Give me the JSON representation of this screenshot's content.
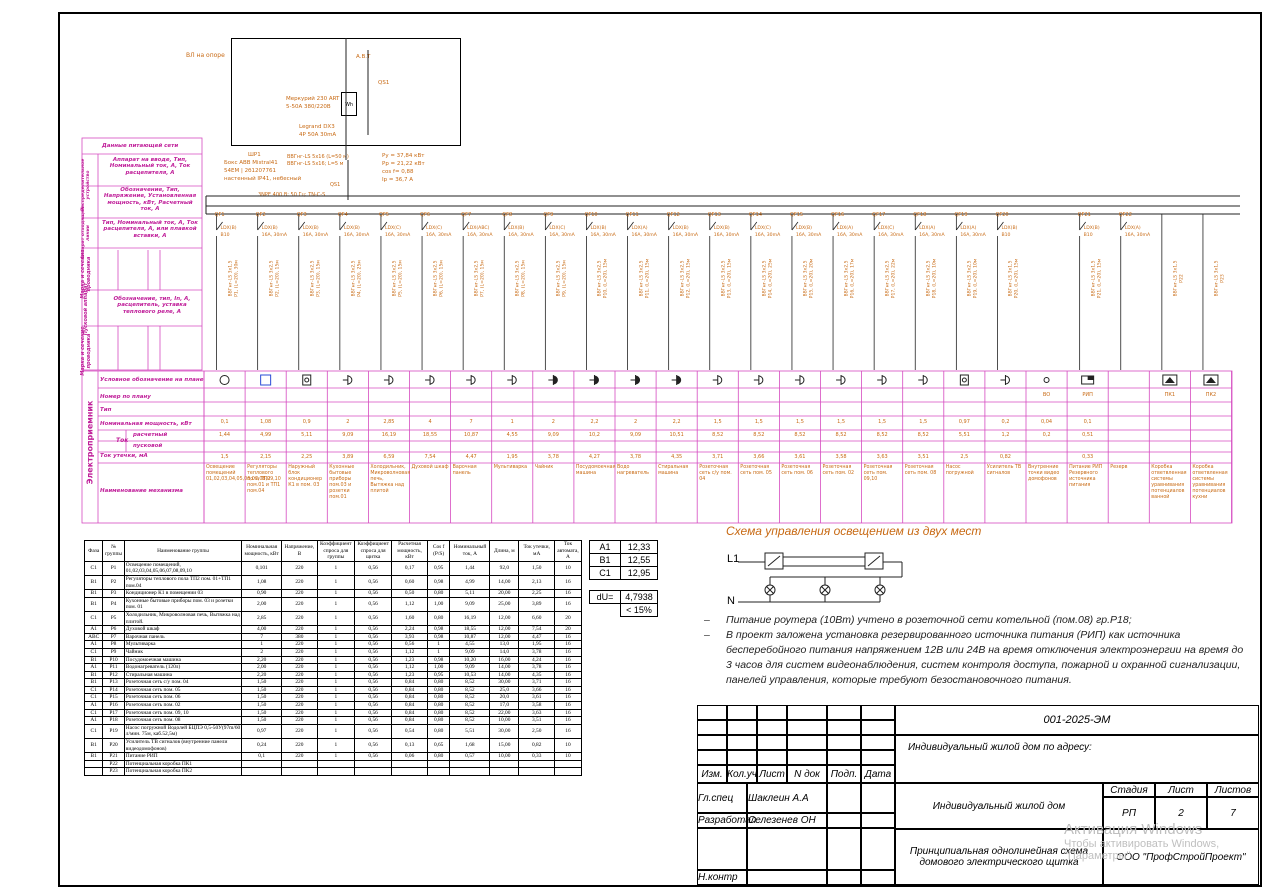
{
  "meter": {
    "pole_label": "ВЛ на опоре",
    "breaker_top": "А.В.Т",
    "qs_label": "QS1",
    "meter_name": "Меркурий 230 ART",
    "meter_spec": "5-50А 380/220В",
    "wh_label": "Wh",
    "legrand": "Legrand DX3",
    "legrand_spec": "4P 50А 30mA",
    "qf_label": "QF1"
  },
  "panel_info": {
    "wp": "ШР1",
    "box": "Бокс ABB Mistral41",
    "box2": "54ЕМ | 2б1207761",
    "box3": "настенный IP41, небесный",
    "cable": "ВВГнг-LS 5х16 (L=50 м)",
    "cable2": "ВВГнг-LS 5х16; L=5 м",
    "pu": "Ру = 37,84 кВт",
    "pr": "Рр = 21,22 кВт",
    "cos": "cos f= 0,88",
    "ir": "Iр = 36,7 А",
    "bus_label": "3NPE 400 В; 50 Гц; TN-C-S",
    "qs2": "QS1"
  },
  "left_labels": {
    "supply": "Данные питающей сети",
    "apparatus": "Аппарат на вводе, Тип, Номинальный ток, А, Ток расцепителя, А",
    "dist": "Распределительное устройство",
    "designation": "Обозначение, Тип, Напряжение, Установленная мощность, кВт, Расчетный ток, А",
    "apparatus2": "Аппарат отходящей линии",
    "type2": "Тип, Номинальный ток, А, Ток расцепителя, А, или плавкой вставки, А",
    "brand": "Марка и сечение проводника",
    "section": "Обозначение, участок сети, длина, м",
    "pipe": "Обозначение трубы",
    "start": "Пусковой аппарат",
    "start_desc": "Обозначение, тип, In, А, расцепитель, уставка теплового реле, А",
    "brand2": "Марка и сечение проводника",
    "receiver": "Электроприемник"
  },
  "receiver_rows": {
    "symbol": "Условное обозначение на плане",
    "plan": "Номер по плану",
    "type": "Тип",
    "power": "Номинальная мощность, кВт",
    "current": "Ток",
    "calc": "расчетный",
    "start": "пусковой",
    "leak": "Ток утечки, мА",
    "name": "Наименование механизма"
  },
  "circuits": [
    {
      "qf": "QF1",
      "ap": "LDX(B)",
      "rat": "B10",
      "cab": "ВВГнг-LS 3х1,5",
      "grp": "Р1, (L=20), 30м",
      "sym": "circle",
      "plan": "",
      "p": "0,1",
      "ic": "1,44",
      "leak": "1,5",
      "name": "Освещение помещений 01,02,03,04,05,06,07,08,09,10"
    },
    {
      "qf": "QF2",
      "ap": "LDX(B)",
      "rat": "16А, 30mA",
      "cab": "ВВГнг-LS 3х2,5",
      "grp": "Р2, (L=20), 15м",
      "sym": "square-blue",
      "plan": "",
      "p": "1,08",
      "ic": "4,99",
      "leak": "2,15",
      "name": "Регуляторы теплового пола ТП2 пом.01 и ТП1 пом.04"
    },
    {
      "qf": "QF3",
      "ap": "LDX(B)",
      "rat": "16А, 30mA",
      "cab": "ВВГнг-LS 3х2,5",
      "grp": "Р3, (L=20), 15м",
      "sym": "square-o",
      "plan": "",
      "p": "0,9",
      "ic": "5,11",
      "leak": "2,25",
      "name": "Наружный блок кондиционер К1 в пом. 03"
    },
    {
      "qf": "QF4",
      "ap": "LDX(B)",
      "rat": "16А, 30mA",
      "cab": "ВВГнг-LS 3х2,5",
      "grp": "Р4, (L=20), 25м",
      "sym": "plug",
      "plan": "",
      "p": "2",
      "ic": "9,09",
      "leak": "3,89",
      "name": "Кухонные бытовые приборы пом.03 и розетки пом.01"
    },
    {
      "qf": "QF5",
      "ap": "LDX(C)",
      "rat": "16А, 30mA",
      "cab": "ВВГнг-LS 3х2,5",
      "grp": "Р5, (L=20), 15м",
      "sym": "plug",
      "plan": "",
      "p": "2,85",
      "ic": "16,19",
      "leak": "6,59",
      "name": "Холодильник, Микроволновая печь, Вытяжка над плитой"
    },
    {
      "qf": "QF6",
      "ap": "LDX(C)",
      "rat": "16А, 30mA",
      "cab": "ВВГнг-LS 3х2,5",
      "grp": "Р6, (L=20), 15м",
      "sym": "plug",
      "plan": "",
      "p": "4",
      "ic": "18,55",
      "leak": "7,54",
      "name": "Духовой шкаф"
    },
    {
      "qf": "QF7",
      "ap": "LDX(ABC)",
      "rat": "16А, 30mA",
      "cab": "ВВГнг-LS 3х2,5",
      "grp": "Р7, (L=20), 15м",
      "sym": "plug",
      "plan": "",
      "p": "7",
      "ic": "10,87",
      "leak": "4,47",
      "name": "Варочная панель"
    },
    {
      "qf": "QF8",
      "ap": "LDX(B)",
      "rat": "16А, 30mA",
      "cab": "ВВГнг-LS 3х2,5",
      "grp": "Р8, (L=20), 15м",
      "sym": "plug",
      "plan": "",
      "p": "1",
      "ic": "4,55",
      "leak": "1,95",
      "name": "Мультиварка"
    },
    {
      "qf": "QF9",
      "ap": "LDX(C)",
      "rat": "16А, 30mA",
      "cab": "ВВГнг-LS 3х2,5",
      "grp": "Р9, (L=20), 15м",
      "sym": "plug-filled",
      "plan": "",
      "p": "2",
      "ic": "9,09",
      "leak": "3,78",
      "name": "Чайник"
    },
    {
      "qf": "QF10",
      "ap": "LDX(B)",
      "rat": "16А, 30mA",
      "cab": "ВВГнг-LS 3х2,5",
      "grp": "Р10, (L=20), 15м",
      "sym": "plug-filled",
      "plan": "",
      "p": "2,2",
      "ic": "10,2",
      "leak": "4,27",
      "name": "Посудомоечная машина"
    },
    {
      "qf": "QF11",
      "ap": "LDX(A)",
      "rat": "16А, 30mA",
      "cab": "ВВГнг-LS 3х2,5",
      "grp": "Р11, (L=20), 15м",
      "sym": "plug-filled",
      "plan": "",
      "p": "2",
      "ic": "9,09",
      "leak": "3,78",
      "name": "Водо нагреватель"
    },
    {
      "qf": "QF12",
      "ap": "LDX(B)",
      "rat": "16А, 30mA",
      "cab": "ВВГнг-LS 3х2,5",
      "grp": "Р12, (L=20), 15м",
      "sym": "plug-filled",
      "plan": "",
      "p": "2,2",
      "ic": "10,51",
      "leak": "4,35",
      "name": "Стиральная машина"
    },
    {
      "qf": "QF13",
      "ap": "LDX(B)",
      "rat": "16А, 30mA",
      "cab": "ВВГнг-LS 3х2,5",
      "grp": "Р13, (L=20), 15м",
      "sym": "plug",
      "plan": "",
      "p": "1,5",
      "ic": "8,52",
      "leak": "3,71",
      "name": "Розеточная сеть с/у пом. 04"
    },
    {
      "qf": "QF14",
      "ap": "LDX(C)",
      "rat": "16А, 30mA",
      "cab": "ВВГнг-LS 3х2,5",
      "grp": "Р14, (L=20), 25м",
      "sym": "plug",
      "plan": "",
      "p": "1,5",
      "ic": "8,52",
      "leak": "3,66",
      "name": "Розеточная сеть пом. 05"
    },
    {
      "qf": "QF15",
      "ap": "LDX(B)",
      "rat": "16А, 30mA",
      "cab": "ВВГнг-LS 3х2,5",
      "grp": "Р15, (L=20), 20м",
      "sym": "plug",
      "plan": "",
      "p": "1,5",
      "ic": "8,52",
      "leak": "3,61",
      "name": "Розеточная сеть пом. 06"
    },
    {
      "qf": "QF16",
      "ap": "LDX(A)",
      "rat": "16А, 30mA",
      "cab": "ВВГнг-LS 3х2,5",
      "grp": "Р16, (L=20), 17м",
      "sym": "plug",
      "plan": "",
      "p": "1,5",
      "ic": "8,52",
      "leak": "3,58",
      "name": "Розеточная сеть пом. 02"
    },
    {
      "qf": "QF17",
      "ap": "LDX(C)",
      "rat": "16А, 30mA",
      "cab": "ВВГнг-LS 3х2,5",
      "grp": "Р17, (L=20), 22м",
      "sym": "plug",
      "plan": "",
      "p": "1,5",
      "ic": "8,52",
      "leak": "3,63",
      "name": "Розеточная сеть пом. 09,10"
    },
    {
      "qf": "QF18",
      "ap": "LDX(A)",
      "rat": "16А, 30mA",
      "cab": "ВВГнг-LS 3х2,5",
      "grp": "Р18, (L=20), 10м",
      "sym": "plug",
      "plan": "",
      "p": "1,5",
      "ic": "8,52",
      "leak": "3,51",
      "name": "Розеточная сеть пом. 08"
    },
    {
      "qf": "QF19",
      "ap": "LDX(A)",
      "rat": "16А, 30mA",
      "cab": "ВВГнг-LS 3х2,5",
      "grp": "Р19, (L=20), 10м",
      "sym": "square-o",
      "plan": "",
      "p": "0,97",
      "ic": "5,51",
      "leak": "2,5",
      "name": "Насос погружной"
    },
    {
      "qf": "QF20",
      "ap": "LDX(B)",
      "rat": "B10",
      "cab": "ВВГнг-LS 3х1,5",
      "grp": "Р20, (L=20), 15м",
      "sym": "plug",
      "plan": "",
      "p": "0,2",
      "ic": "1,2",
      "leak": "0,82",
      "name": "Усилитель ТВ сигналов"
    },
    {
      "qf": "",
      "ap": "",
      "rat": "",
      "cab": "",
      "grp": "",
      "sym": "circle-small",
      "plan": "ВО",
      "p": "0,04",
      "ic": "0,2",
      "leak": "",
      "name": "Внутренние точки видео домофонов"
    },
    {
      "qf": "QF21",
      "ap": "LDX(B)",
      "rat": "B10",
      "cab": "ВВГнг-LS 3х1,5",
      "grp": "Р21, (L=20), 15м",
      "sym": "rip",
      "plan": "РИП",
      "p": "0,1",
      "ic": "0,51",
      "leak": "0,33",
      "name": "Питание РИП Резервного источника питания"
    },
    {
      "qf": "QF22",
      "ap": "LDX(A)",
      "rat": "16А, 30mA",
      "cab": "",
      "grp": "",
      "sym": "none",
      "plan": "",
      "p": "",
      "ic": "",
      "leak": "",
      "name": "Резерв"
    },
    {
      "qf": "",
      "ap": "",
      "rat": "",
      "cab": "ВВГнг-LS 3х1,5",
      "grp": "Р22",
      "sym": "triangle",
      "plan": "ПК1",
      "p": "",
      "ic": "",
      "leak": "",
      "name": "Коробка ответвленная системы уравнивания потенциалов ванной"
    },
    {
      "qf": "",
      "ap": "",
      "rat": "",
      "cab": "ВВГнг-LS 3х1,5",
      "grp": "Р23",
      "sym": "triangle",
      "plan": "ПК2",
      "p": "",
      "ic": "",
      "leak": "",
      "name": "Коробка ответвленная системы уравнивания потенциалов кухни"
    }
  ],
  "spec_table": {
    "headers": [
      "Фаза",
      "№ группы",
      "Наименование группы",
      "Номинальная мощность, кВт",
      "Напряжение, В",
      "Коэффициент спроса для группы",
      "Коэффициент спроса для щитка",
      "Расчетная мощность, кВт",
      "Cos f (P/S)",
      "Номинальный ток, А",
      "Длина, м",
      "Ток утечки, мА",
      "Ток автомата, А"
    ],
    "rows": [
      [
        "С1",
        "Р1",
        "Освещение помещений, 01,02,03,04,05,06,07,08,09,10",
        "0,101",
        "220",
        "1",
        "0,56",
        "0,17",
        "0,95",
        "1,44",
        "92,0",
        "1,50",
        "10"
      ],
      [
        "В1",
        "Р2",
        "Регуляторы теплового пола ТП2 пом. 01+ТП1 пом.04",
        "1,08",
        "220",
        "1",
        "0,56",
        "0,60",
        "0,98",
        "4,99",
        "14,00",
        "2,13",
        "16"
      ],
      [
        "В1",
        "Р3",
        "Кондиционер К1 в помещении 03",
        "0,90",
        "220",
        "1",
        "0,56",
        "0,50",
        "0,80",
        "5,11",
        "20,00",
        "2,25",
        "16"
      ],
      [
        "В1",
        "Р4",
        "Кухонные бытовые приборы пом. 03 и розетки пом. 01",
        "2,00",
        "220",
        "1",
        "0,56",
        "1,12",
        "1,00",
        "9,09",
        "25,00",
        "3,89",
        "16"
      ],
      [
        "С1",
        "Р5",
        "Холодильник, Микроволновая печь, Вытяжка над плитой.",
        "2,85",
        "220",
        "1",
        "0,56",
        "1,60",
        "0,80",
        "16,19",
        "12,00",
        "6,60",
        "20"
      ],
      [
        "А1",
        "Р6",
        "Духовой шкаф",
        "4,00",
        "220",
        "1",
        "0,56",
        "2,24",
        "0,98",
        "18,55",
        "12,00",
        "7,54",
        "20"
      ],
      [
        "АВС",
        "Р7",
        "Варочная панель",
        "7",
        "380",
        "1",
        "0,56",
        "3,93",
        "0,98",
        "10,87",
        "12,00",
        "4,47",
        "16"
      ],
      [
        "А1",
        "Р8",
        "Мультиварка",
        "1",
        "220",
        "1",
        "0,56",
        "0,56",
        "1",
        "4,55",
        "13,0",
        "1,95",
        "16"
      ],
      [
        "С1",
        "Р9",
        "Чайник",
        "2",
        "220",
        "1",
        "0,56",
        "1,12",
        "1",
        "9,09",
        "14,0",
        "3,78",
        "16"
      ],
      [
        "В1",
        "Р10",
        "Посудомоечная машина",
        "2,20",
        "220",
        "1",
        "0,56",
        "1,23",
        "0,98",
        "10,20",
        "16,00",
        "4,24",
        "16"
      ],
      [
        "А1",
        "Р11",
        "Водонагреватель (120л)",
        "2,00",
        "220",
        "1",
        "0,56",
        "1,12",
        "1,00",
        "9,09",
        "14,00",
        "3,78",
        "16"
      ],
      [
        "В1",
        "Р12",
        "Стиральная машина",
        "2,20",
        "220",
        "1",
        "0,56",
        "1,23",
        "0,95",
        "10,53",
        "14,00",
        "4,35",
        "16"
      ],
      [
        "В1",
        "Р13",
        "Розеточная сеть с/у пом. 04",
        "1,50",
        "220",
        "1",
        "0,56",
        "0,84",
        "0,80",
        "8,52",
        "30,00",
        "3,71",
        "16"
      ],
      [
        "С1",
        "Р14",
        "Розеточная сеть пом. 05",
        "1,50",
        "220",
        "1",
        "0,56",
        "0,84",
        "0,80",
        "8,52",
        "25,0",
        "3,66",
        "16"
      ],
      [
        "С1",
        "Р15",
        "Розеточная сеть пом. 06",
        "1,50",
        "220",
        "1",
        "0,56",
        "0,84",
        "0,80",
        "8,52",
        "20,0",
        "3,61",
        "16"
      ],
      [
        "А1",
        "Р16",
        "Розеточная сеть пом. 02",
        "1,50",
        "220",
        "1",
        "0,56",
        "0,84",
        "0,80",
        "8,52",
        "17,0",
        "3,58",
        "16"
      ],
      [
        "С1",
        "Р17",
        "Розеточная сеть пом. 09, 10",
        "1,50",
        "220",
        "1",
        "0,56",
        "0,84",
        "0,80",
        "8,52",
        "22,00",
        "3,63",
        "16"
      ],
      [
        "А1",
        "Р18",
        "Розеточная сеть пом. 08",
        "1,50",
        "220",
        "1",
        "0,56",
        "0,84",
        "0,80",
        "8,52",
        "10,00",
        "3,51",
        "16"
      ],
      [
        "С1",
        "Р19",
        "Насос погружной Водолей БЦПЭ 0,5-50У(97m/60 л/мин. 75м, каб.52,5м)",
        "0,97",
        "220",
        "1",
        "0,56",
        "0,54",
        "0,80",
        "5,51",
        "30,00",
        "2,50",
        "16"
      ],
      [
        "В1",
        "Р20",
        "Усилитель ТВ сигналов (внутренние панели видеодомофонов)",
        "0,24",
        "220",
        "1",
        "0,56",
        "0,13",
        "0,65",
        "1,68",
        "15,00",
        "0,82",
        "10"
      ],
      [
        "В1",
        "Р21",
        "Питание РИП",
        "0,1",
        "220",
        "1",
        "0,56",
        "0,06",
        "0,80",
        "0,57",
        "10,00",
        "0,33",
        "10"
      ],
      [
        "",
        "Р22",
        "Потенциальная коробка ПК1",
        "",
        "",
        "",
        "",
        "",
        "",
        "",
        "",
        "",
        ""
      ],
      [
        "",
        "Р23",
        "Потенциальная коробка ПК2",
        "",
        "",
        "",
        "",
        "",
        "",
        "",
        "",
        "",
        ""
      ]
    ]
  },
  "phase_table": [
    [
      "А1",
      "12,33"
    ],
    [
      "В1",
      "12,55"
    ],
    [
      "С1",
      "12,95"
    ]
  ],
  "du": {
    "label": "dU=",
    "value": "4,7938",
    "limit": "< 15%"
  },
  "lighting": {
    "title": "Схема управления освещением из двух мест",
    "l1": "L1",
    "n": "N"
  },
  "notes": [
    "Питание роутера (10Вт) учтено в розеточной сети котельной (пом.08) гр.Р18;",
    "В проект заложена установка резервированного источника питания (РИП) как источника бесперебойного питания  напряжением 12В или 24В на время отключения электроэнергии на время до 3 часов для систем видеонаблюдения, систем контроля доступа, пожарной и охранной сигнализации, панелей управления, которые требуют безостановочного питания."
  ],
  "title_block": {
    "code": "001-2025-ЭМ",
    "object": "Индивидуальный жилой дом по адресу:",
    "building": "Индивидуальный жилой дом",
    "sheet_title": "Принципиальная однолинейная схема домового электрического щитка",
    "company": "ООО \"ПрофСтройПроект\"",
    "izm": "Изм.",
    "kol": "Кол.уч",
    "list": "Лист",
    "ndok": "N док",
    "podp": "Подп.",
    "data": "Дата",
    "stage_h": "Стадия",
    "list_h": "Лист",
    "lists_h": "Листов",
    "stage": "РП",
    "sheet": "2",
    "sheets": "7",
    "glspec": "Гл.спец",
    "glspec_name": "Шаклеин А.А",
    "razr": "Разработал",
    "razr_name": "Селезенев ОН",
    "nkontr": "Н.контр"
  },
  "watermark": {
    "line1": "Активация Windows",
    "line2": "Чтобы активировать Windows,",
    "line3": "\"Параметры\"."
  }
}
